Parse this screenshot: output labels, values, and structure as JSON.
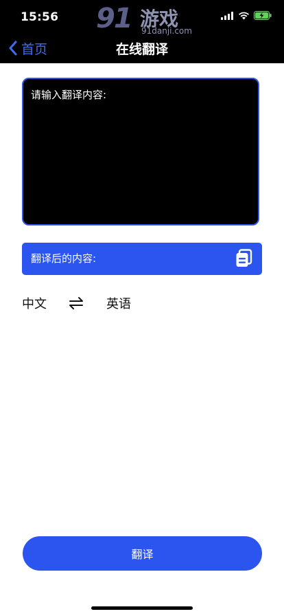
{
  "status_bar": {
    "time": "15:56"
  },
  "watermark": {
    "number": "91",
    "brand": "游戏",
    "url": "91danji.com"
  },
  "nav": {
    "back_label": "首页",
    "title": "在线翻译"
  },
  "input": {
    "placeholder": "请输入翻译内容:",
    "value": ""
  },
  "result": {
    "label": "翻译后的内容:"
  },
  "language": {
    "source": "中文",
    "target": "英语"
  },
  "actions": {
    "translate_label": "翻译"
  },
  "colors": {
    "accent": "#2b55ee",
    "nav_link": "#3d6cf5",
    "header_bg": "#000000"
  },
  "icons": {
    "back": "chevron-left-icon",
    "copy": "copy-icon",
    "swap": "swap-arrows-icon",
    "signal": "signal-icon",
    "wifi": "wifi-icon",
    "battery": "battery-charging-icon"
  }
}
